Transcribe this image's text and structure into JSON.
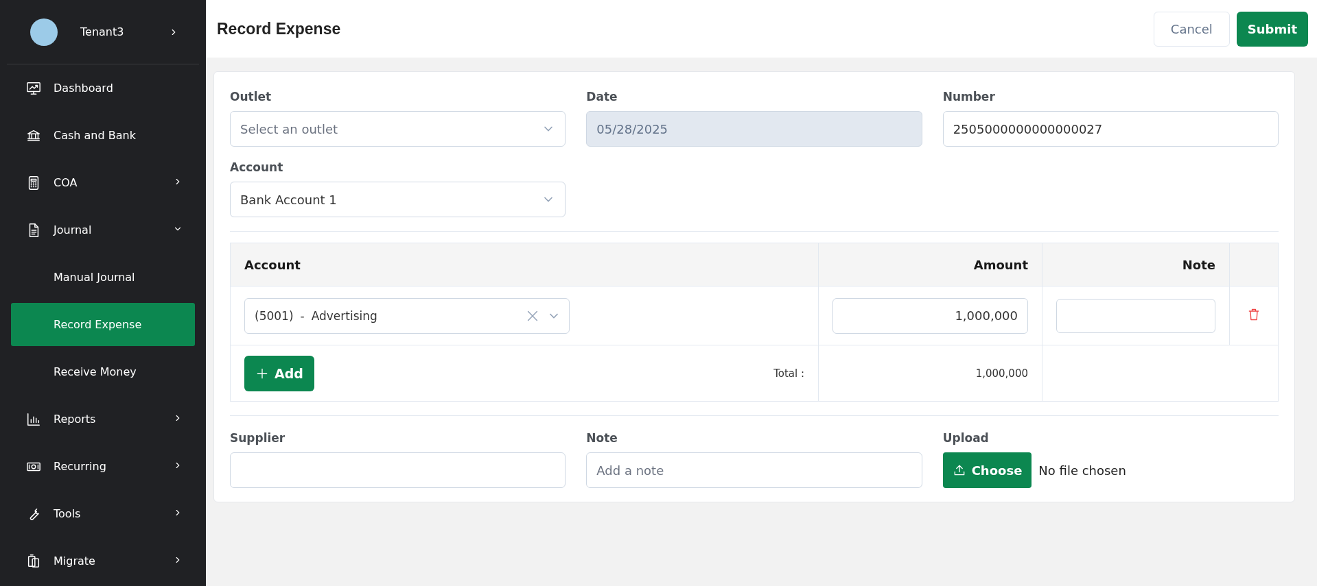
{
  "sidebar": {
    "user": {
      "name": "Tenant3"
    },
    "items": [
      {
        "label": "Dashboard",
        "kind": "link",
        "selected": false
      },
      {
        "label": "Cash and Bank",
        "kind": "link",
        "selected": false
      },
      {
        "label": "COA",
        "kind": "group",
        "expanded": false,
        "selected": false
      },
      {
        "label": "Journal",
        "kind": "group",
        "expanded": true,
        "selected": false,
        "children": [
          {
            "label": "Manual Journal",
            "selected": false
          },
          {
            "label": "Record Expense",
            "selected": true
          },
          {
            "label": "Receive Money",
            "selected": false
          }
        ]
      },
      {
        "label": "Reports",
        "kind": "group",
        "expanded": false,
        "selected": false
      },
      {
        "label": "Recurring",
        "kind": "group",
        "expanded": false,
        "selected": false
      },
      {
        "label": "Tools",
        "kind": "group",
        "expanded": false,
        "selected": false
      },
      {
        "label": "Migrate",
        "kind": "group",
        "expanded": false,
        "selected": false
      }
    ]
  },
  "header": {
    "title": "Record Expense",
    "buttons": [
      {
        "label": "Cancel",
        "kind": "secondary"
      },
      {
        "label": "Submit",
        "kind": "primary"
      }
    ]
  },
  "form": {
    "outlet": {
      "label": "Outlet",
      "placeholder": "Select an outlet"
    },
    "date": {
      "label": "Date",
      "value": "05/28/2025",
      "disabled": true
    },
    "number": {
      "label": "Number",
      "value": "2505000000000000027"
    },
    "account": {
      "label": "Account",
      "value": "Bank Account 1"
    }
  },
  "table": {
    "columns": [
      "Account",
      "Amount",
      "Note"
    ],
    "rows": [
      {
        "account_code": "(5001)",
        "separator": "-",
        "account_name": "Advertising",
        "amount": "1,000,000"
      }
    ],
    "add_button": "Add",
    "total_label": "Total :",
    "total": "1,000,000"
  },
  "bottom": {
    "supplier": {
      "label": "Supplier"
    },
    "note": {
      "label": "Note",
      "placeholder": "Add a note"
    },
    "upload": {
      "label": "Upload",
      "button": "Choose",
      "status": "No file chosen"
    }
  }
}
